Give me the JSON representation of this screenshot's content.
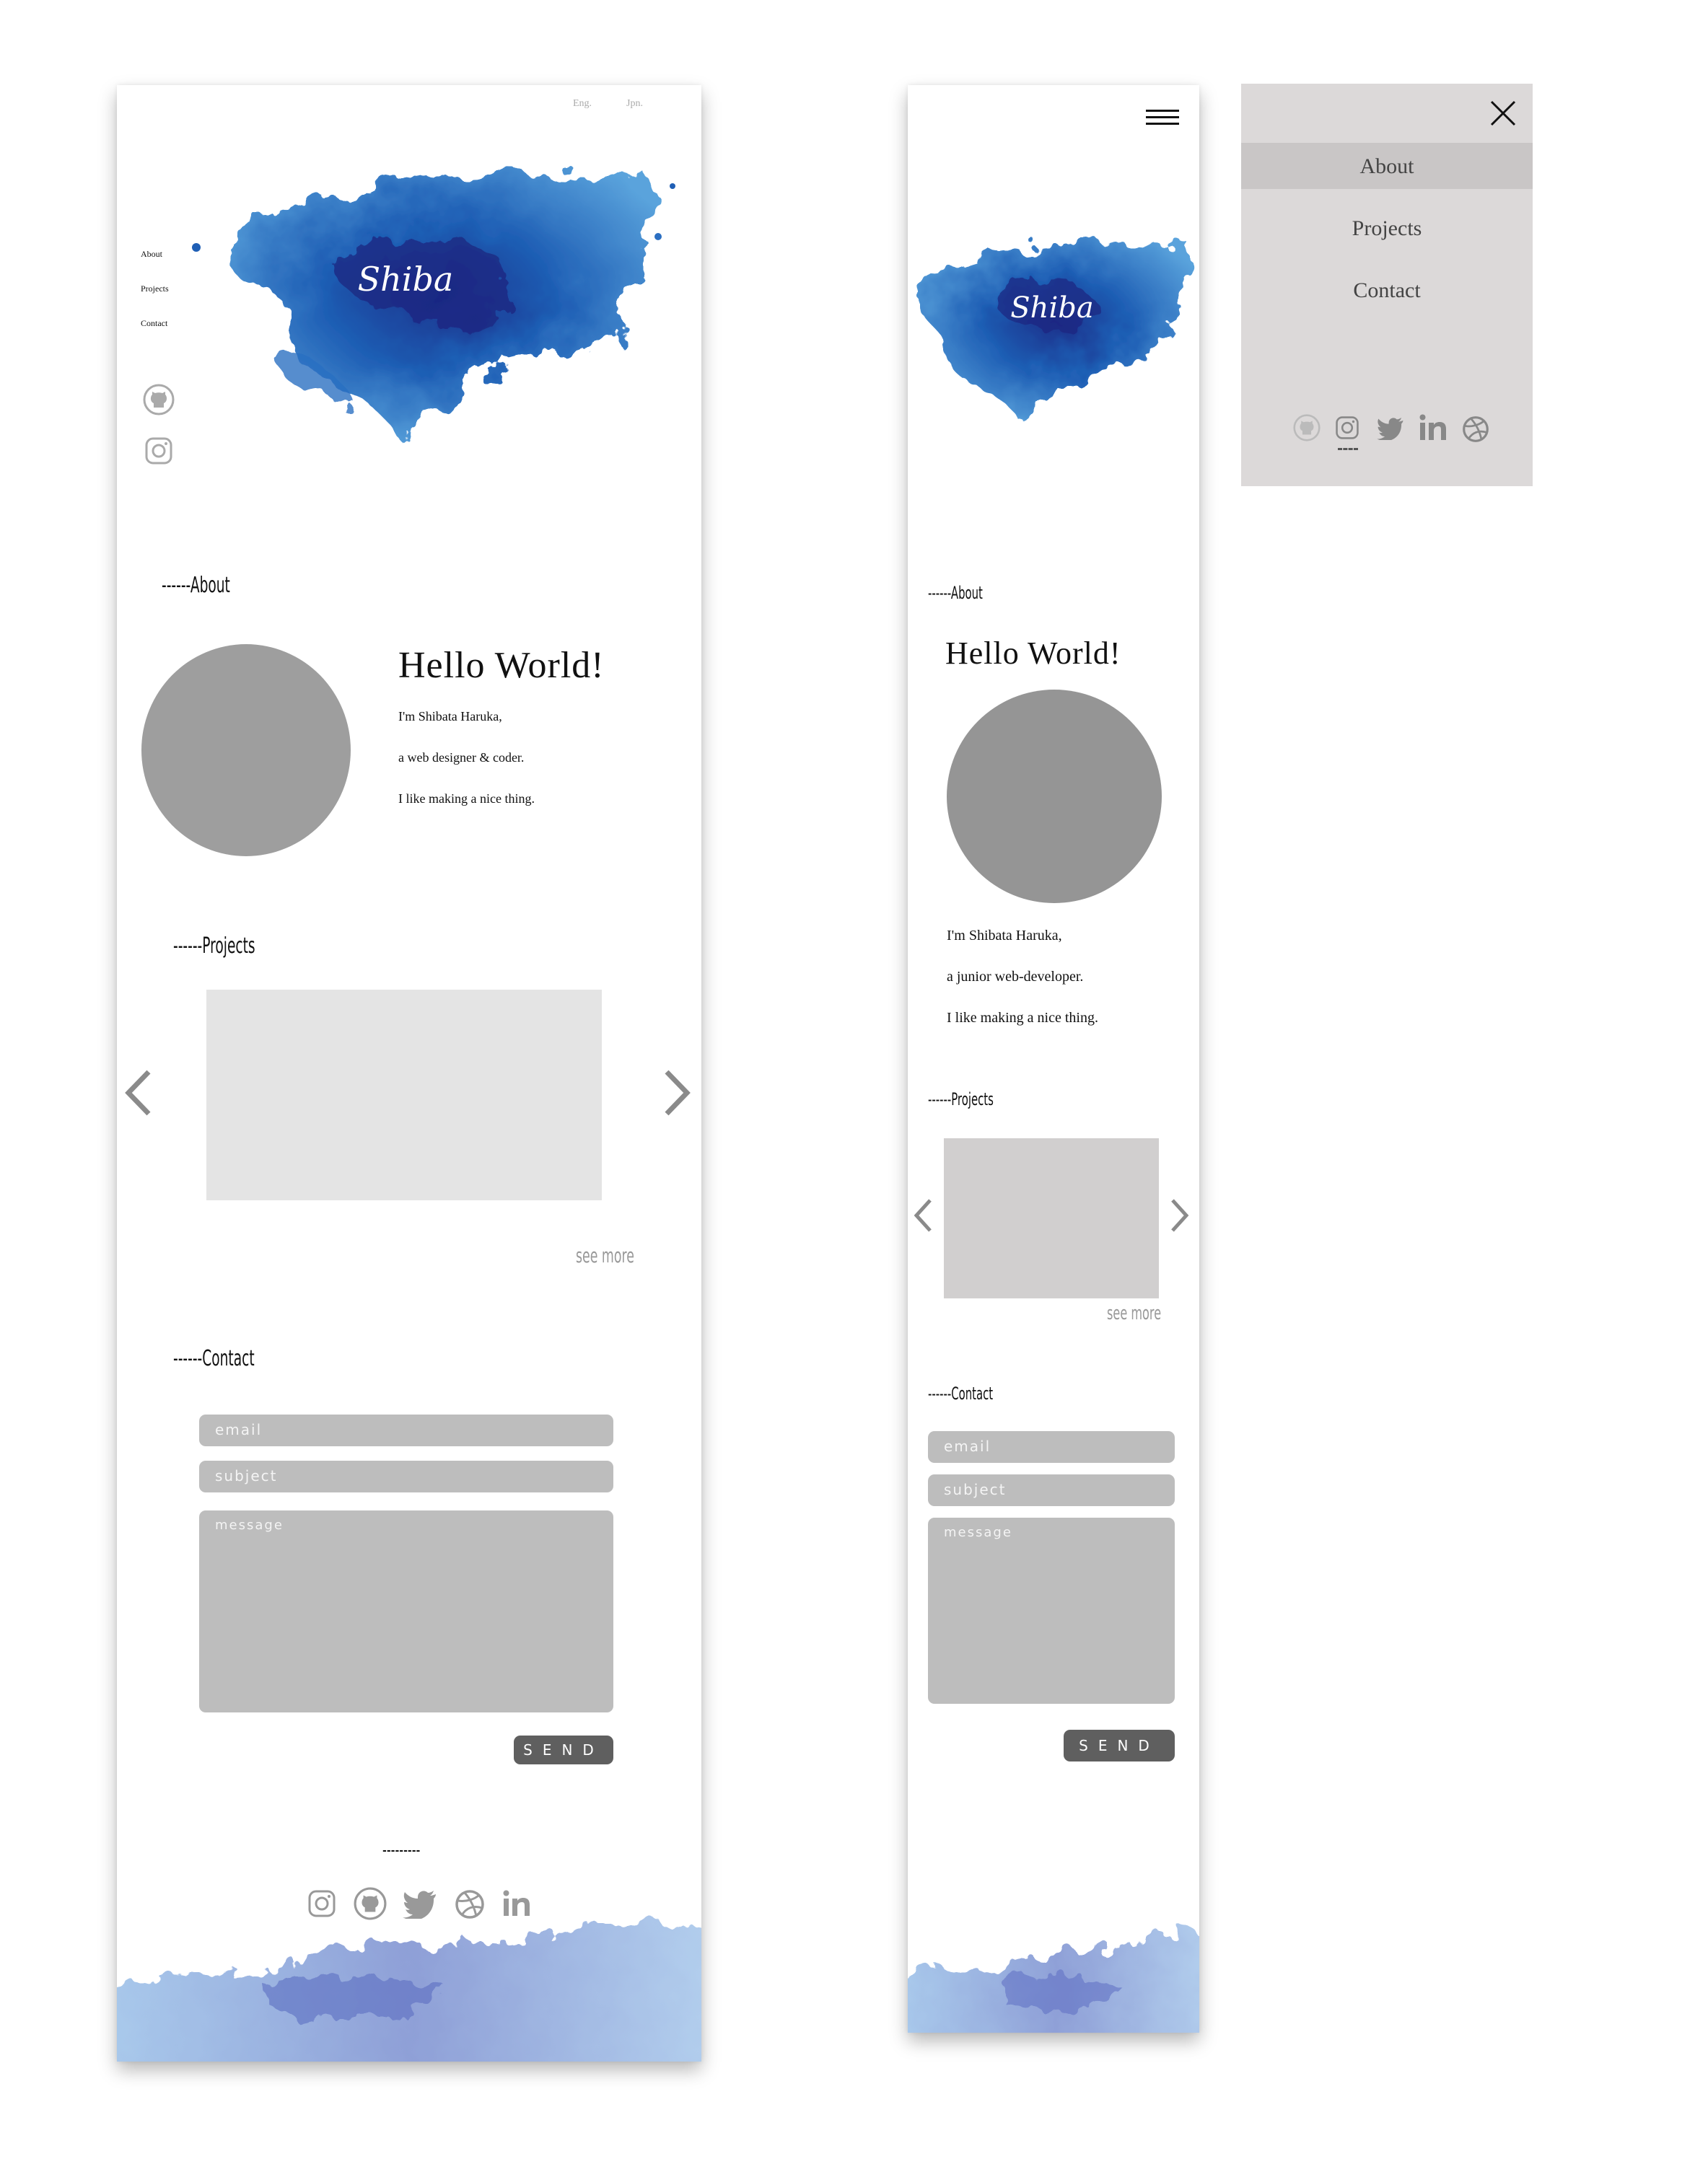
{
  "desktop": {
    "lang": {
      "eng": "Eng.",
      "jpn": "Jpn."
    },
    "side_nav": [
      "About",
      "Projects",
      "Contact"
    ],
    "logo_text": "Shiba",
    "about": {
      "heading": "------About",
      "hello": "Hello World!",
      "lines": [
        "I'm Shibata Haruka,",
        "a web designer & coder.",
        "I like making a nice thing."
      ]
    },
    "projects": {
      "heading": "------Projects",
      "see_more": "see more"
    },
    "contact": {
      "heading": "------Contact",
      "email_placeholder": "email",
      "subject_placeholder": "subject",
      "message_placeholder": "message",
      "send": "SEND"
    },
    "footer_divider": "---------",
    "footer_icons": [
      "instagram-icon",
      "github-icon",
      "twitter-icon",
      "dribbble-icon",
      "linkedin-icon"
    ]
  },
  "mobile": {
    "logo_text": "Shiba",
    "about": {
      "heading": "------About",
      "hello": "Hello World!",
      "lines": [
        "I'm Shibata Haruka,",
        "a junior web-developer.",
        "I like making a nice thing."
      ]
    },
    "projects": {
      "heading": "------Projects",
      "see_more": "see more"
    },
    "contact": {
      "heading": "------Contact",
      "email_placeholder": "email",
      "subject_placeholder": "subject",
      "message_placeholder": "message",
      "send": "SEND"
    }
  },
  "menu": {
    "items": [
      "About",
      "Projects",
      "Contact"
    ],
    "active": "About",
    "icons": [
      "github-icon",
      "instagram-icon",
      "twitter-icon",
      "linkedin-icon",
      "dribbble-icon"
    ]
  },
  "colors": {
    "watercolor": "#1f5fb5",
    "placeholder": "#9a9a9a",
    "field": "#bdbdbd",
    "send": "#5f5f5f",
    "menu_bg": "#dcd9d9"
  }
}
